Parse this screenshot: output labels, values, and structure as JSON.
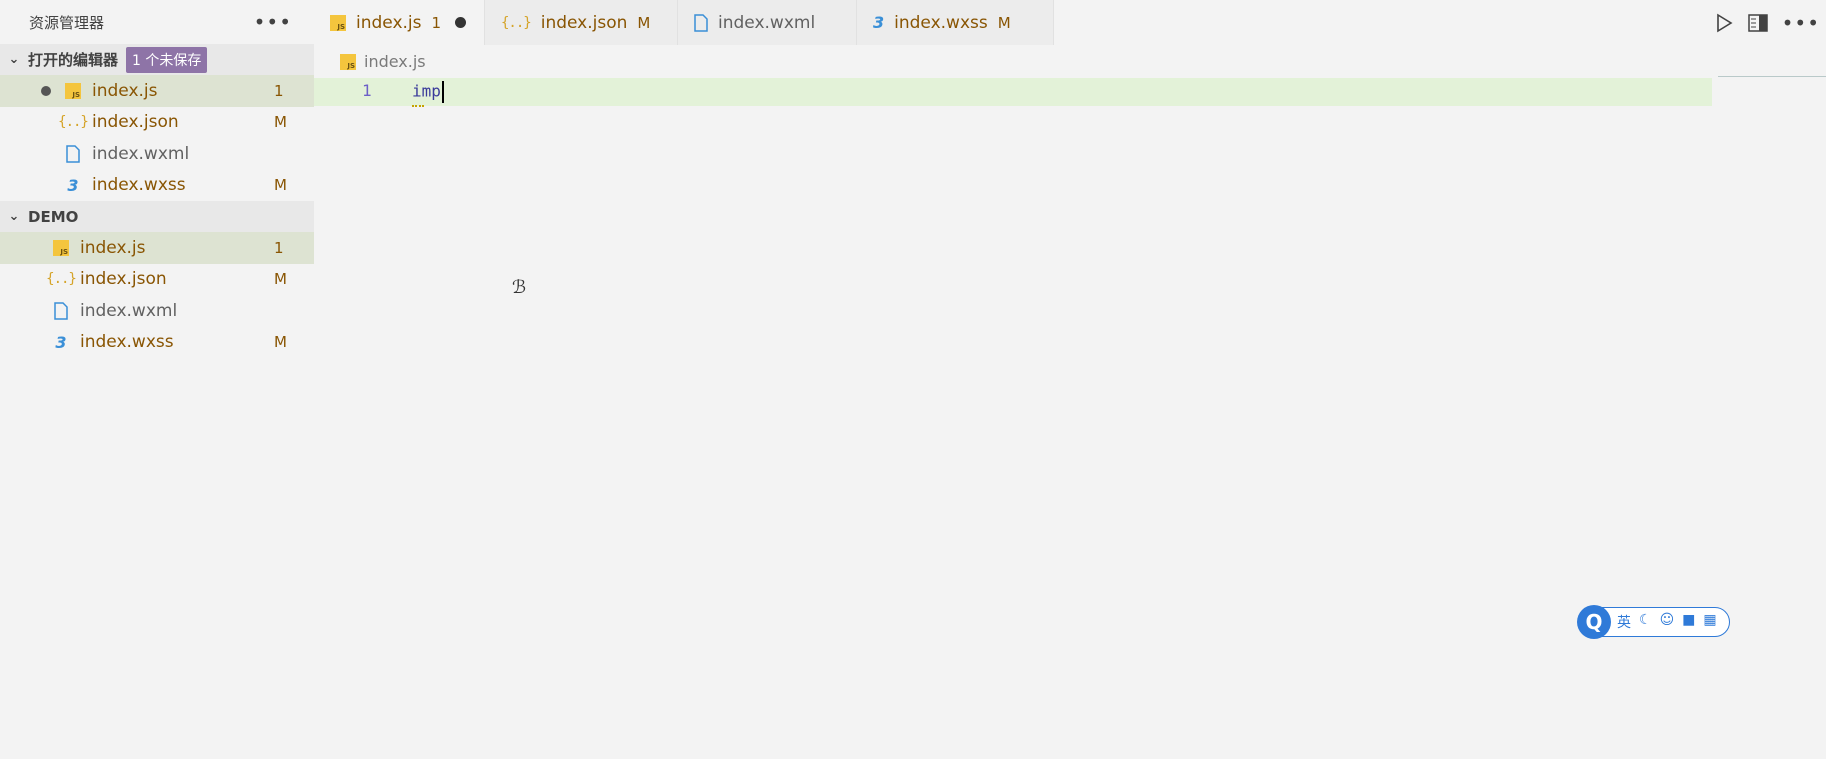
{
  "sidebar": {
    "title": "资源管理器",
    "more_icon": "•••",
    "open_editors": {
      "label": "打开的编辑器",
      "badge": "1 个未保存",
      "files": [
        {
          "name": "index.js",
          "status": "1",
          "icon": "js-icon",
          "selected": true,
          "dirty": true
        },
        {
          "name": "index.json",
          "status": "M",
          "icon": "json-icon"
        },
        {
          "name": "index.wxml",
          "status": "",
          "icon": "file-icon"
        },
        {
          "name": "index.wxss",
          "status": "M",
          "icon": "css-icon"
        }
      ]
    },
    "project": {
      "label": "DEMO",
      "files": [
        {
          "name": "index.js",
          "status": "1",
          "icon": "js-icon",
          "selected": true
        },
        {
          "name": "index.json",
          "status": "M",
          "icon": "json-icon"
        },
        {
          "name": "index.wxml",
          "status": "",
          "icon": "file-icon"
        },
        {
          "name": "index.wxss",
          "status": "M",
          "icon": "css-icon"
        }
      ]
    }
  },
  "tabs": [
    {
      "label": "index.js",
      "suffix": "1",
      "dirty": true,
      "icon": "js-icon"
    },
    {
      "label": "index.json",
      "suffix": "M",
      "icon": "json-icon"
    },
    {
      "label": "index.wxml",
      "suffix": "",
      "icon": "file-icon"
    },
    {
      "label": "index.wxss",
      "suffix": "M",
      "icon": "css-icon"
    }
  ],
  "breadcrumb": "index.js",
  "editor": {
    "line_number": "1",
    "code": "imp"
  },
  "ime": {
    "logo": "Q",
    "lang": "英"
  },
  "colors": {
    "modified": "#895503",
    "badge": "#8e74a7",
    "line_highlight": "#e3f2d8",
    "ime_blue": "#2f7ad8"
  }
}
